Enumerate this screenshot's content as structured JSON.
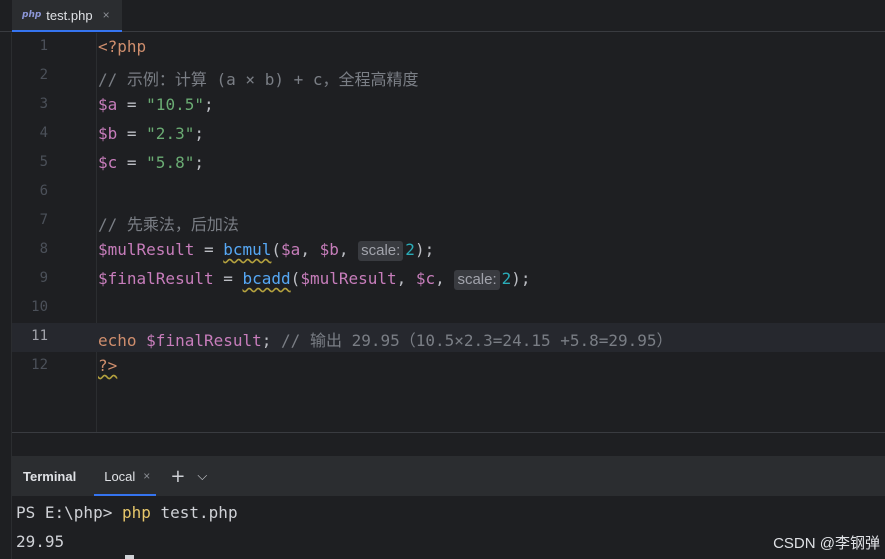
{
  "tab": {
    "icon": "php",
    "label": "test.php",
    "close": "×"
  },
  "code": {
    "line_numbers": [
      "1",
      "2",
      "3",
      "4",
      "5",
      "6",
      "7",
      "8",
      "9",
      "10",
      "11",
      "12"
    ],
    "l1": "<?php",
    "l2": "// 示例：计算 (a × b) + c，全程高精度",
    "l3_var": "$a",
    "l3_eq": " = ",
    "l3_str": "\"10.5\"",
    "l3_end": ";",
    "l4_var": "$b",
    "l4_eq": " = ",
    "l4_str": "\"2.3\"",
    "l4_end": ";",
    "l5_var": "$c",
    "l5_eq": " = ",
    "l5_str": "\"5.8\"",
    "l5_end": ";",
    "l7": "// 先乘法，后加法",
    "l8_var": "$mulResult",
    "l8_eq": " = ",
    "l8_fn": "bcmul",
    "l8_open": "(",
    "l8_a1": "$a",
    "l8_comma1": ", ",
    "l8_a2": "$b",
    "l8_comma2": ", ",
    "l8_hint": "scale:",
    "l8_num": "2",
    "l8_end": ");",
    "l9_var": "$finalResult",
    "l9_eq": " = ",
    "l9_fn": "bcadd",
    "l9_open": "(",
    "l9_a1": "$mulResult",
    "l9_comma1": ", ",
    "l9_a2": "$c",
    "l9_comma2": ", ",
    "l9_hint": "scale:",
    "l9_num": "2",
    "l9_end": ");",
    "l11_kw": "echo",
    "l11_sp": " ",
    "l11_var": "$finalResult",
    "l11_semi": ";",
    "l11_cmt": " // 输出 29.95（10.5×2.3=24.15 +5.8=29.95）",
    "l12": "?>"
  },
  "terminal": {
    "title": "Terminal",
    "tab_label": "Local",
    "tab_close": "×",
    "add": "+",
    "dropdown": "⌵",
    "prompt": "PS E:\\php> ",
    "command": "php",
    "args": " test.php",
    "output": "29.95"
  },
  "watermark": "CSDN @李钢弹",
  "colors": {
    "accent": "#3574f0",
    "keyword": "#cf8e6d",
    "variable": "#c77dbb",
    "string": "#6aab73",
    "function": "#56a8f5",
    "number": "#2aacb8"
  }
}
